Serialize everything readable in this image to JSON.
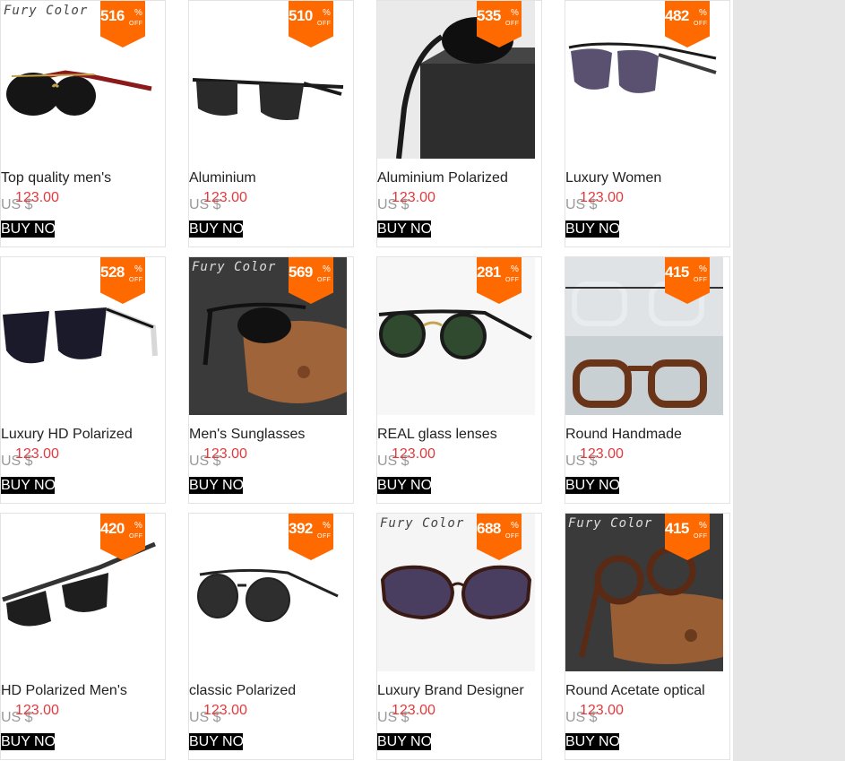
{
  "currency_label": "US $",
  "badge_pct": "%",
  "badge_off": "OFF",
  "buy_label": "BUY NOW",
  "brand_label": "Fury Color",
  "products": [
    {
      "title": "Top quality men's",
      "price": "123.00",
      "discount": "516"
    },
    {
      "title": "Aluminium",
      "price": "123.00",
      "discount": "510"
    },
    {
      "title": "Aluminium Polarized",
      "price": "123.00",
      "discount": "535"
    },
    {
      "title": "Luxury Women",
      "price": "123.00",
      "discount": "482"
    },
    {
      "title": "Luxury HD Polarized",
      "price": "123.00",
      "discount": "528"
    },
    {
      "title": "Men's Sunglasses",
      "price": "123.00",
      "discount": "569"
    },
    {
      "title": "REAL glass lenses",
      "price": "123.00",
      "discount": "281"
    },
    {
      "title": "Round Handmade",
      "price": "123.00",
      "discount": "415"
    },
    {
      "title": "HD Polarized Men's",
      "price": "123.00",
      "discount": "420"
    },
    {
      "title": "classic Polarized",
      "price": "123.00",
      "discount": "392"
    },
    {
      "title": "Luxury Brand Designer",
      "price": "123.00",
      "discount": "688"
    },
    {
      "title": "Round Acetate optical",
      "price": "123.00",
      "discount": "415"
    }
  ]
}
